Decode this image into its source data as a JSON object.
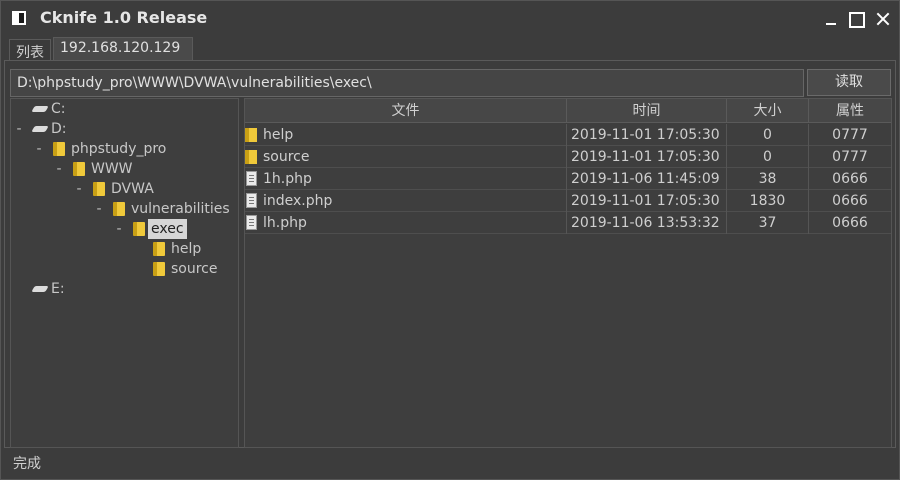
{
  "window": {
    "title": "Cknife 1.0 Release"
  },
  "tabs": [
    {
      "label": "列表"
    },
    {
      "label": "192.168.120.129"
    }
  ],
  "toolbar": {
    "path": "D:\\phpstudy_pro\\WWW\\DVWA\\vulnerabilities\\exec\\",
    "read_label": "读取"
  },
  "tree": {
    "items": [
      {
        "label": "C:",
        "type": "drive",
        "expanded": false
      },
      {
        "label": "D:",
        "type": "drive",
        "expanded": true
      },
      {
        "label": "phpstudy_pro",
        "type": "folder",
        "expanded": true
      },
      {
        "label": "WWW",
        "type": "folder",
        "expanded": true
      },
      {
        "label": "DVWA",
        "type": "folder",
        "expanded": true
      },
      {
        "label": "vulnerabilities",
        "type": "folder",
        "expanded": true
      },
      {
        "label": "exec",
        "type": "folder",
        "expanded": true,
        "selected": true
      },
      {
        "label": "help",
        "type": "folder",
        "expanded": false
      },
      {
        "label": "source",
        "type": "folder",
        "expanded": false
      },
      {
        "label": "E:",
        "type": "drive",
        "expanded": false
      }
    ]
  },
  "table": {
    "headers": {
      "name": "文件",
      "time": "时间",
      "size": "大小",
      "attr": "属性"
    },
    "rows": [
      {
        "type": "folder",
        "name": "help",
        "time": "2019-11-01 17:05:30",
        "size": "0",
        "attr": "0777"
      },
      {
        "type": "folder",
        "name": "source",
        "time": "2019-11-01 17:05:30",
        "size": "0",
        "attr": "0777"
      },
      {
        "type": "file",
        "name": "1h.php",
        "time": "2019-11-06 11:45:09",
        "size": "38",
        "attr": "0666"
      },
      {
        "type": "file",
        "name": "index.php",
        "time": "2019-11-01 17:05:30",
        "size": "1830",
        "attr": "0666"
      },
      {
        "type": "file",
        "name": "lh.php",
        "time": "2019-11-06 13:53:32",
        "size": "37",
        "attr": "0666"
      }
    ]
  },
  "status": {
    "text": "完成"
  }
}
